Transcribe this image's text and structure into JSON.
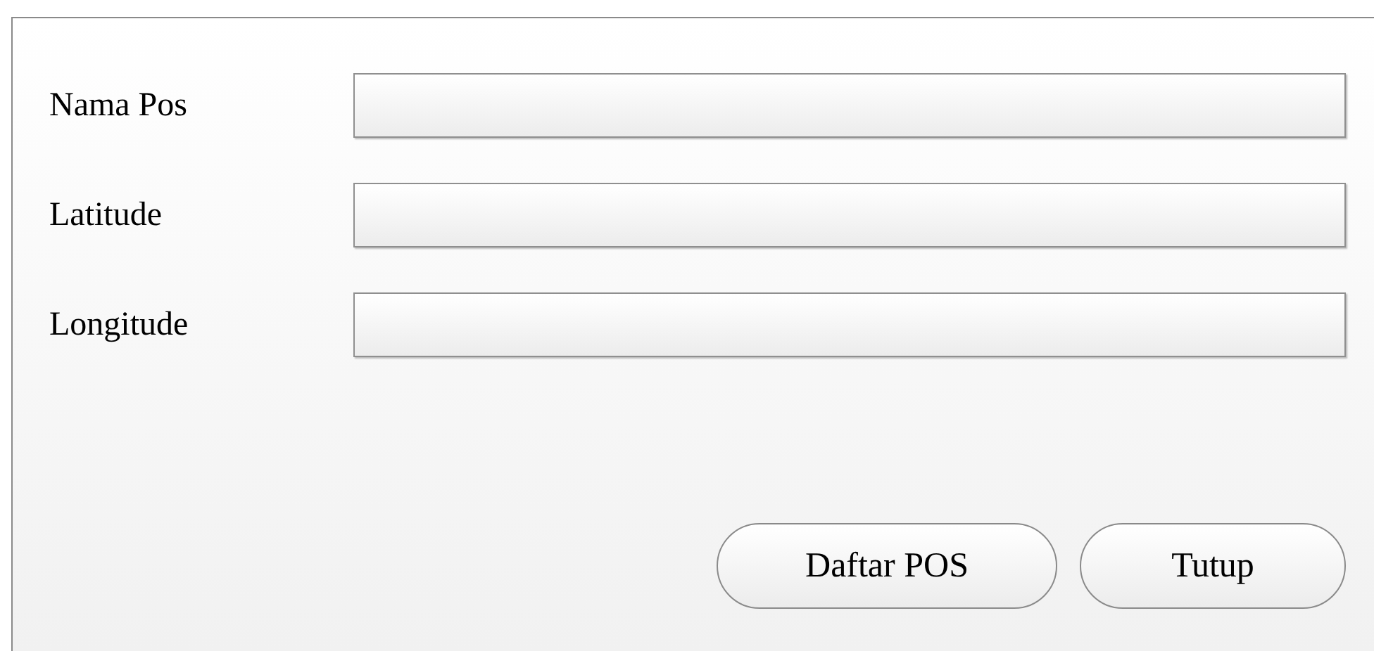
{
  "fields": [
    {
      "label": "Nama Pos"
    },
    {
      "label": "Latitude"
    },
    {
      "label": "Longitude"
    }
  ],
  "buttons": [
    "Daftar POS",
    "Tutup"
  ]
}
